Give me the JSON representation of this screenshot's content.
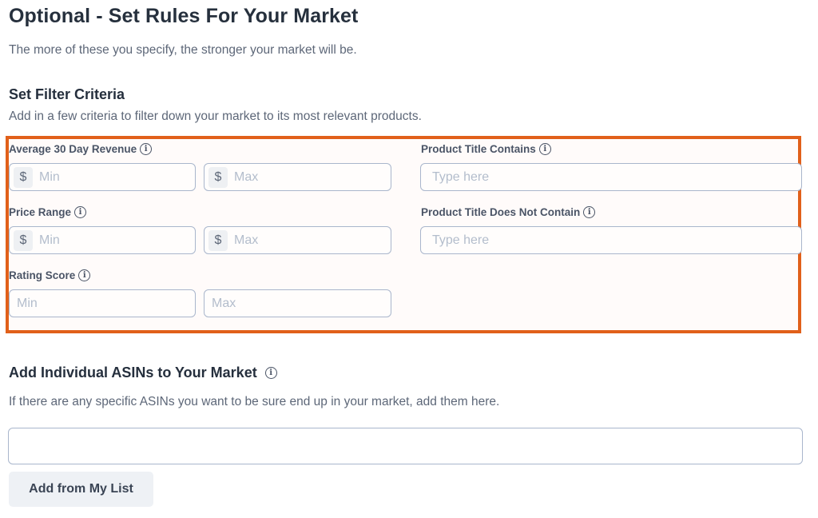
{
  "header": {
    "title": "Optional - Set Rules For Your Market",
    "subtitle": "The more of these you specify, the stronger your market will be."
  },
  "filter_section": {
    "title": "Set Filter Criteria",
    "description": "Add in a few criteria to filter down your market to its most relevant products.",
    "highlight_color": "#e1601a",
    "fields": {
      "avg_revenue": {
        "label": "Average 30 Day Revenue",
        "prefix": "$",
        "min_placeholder": "Min",
        "max_placeholder": "Max",
        "min_value": "",
        "max_value": ""
      },
      "price_range": {
        "label": "Price Range",
        "prefix": "$",
        "min_placeholder": "Min",
        "max_placeholder": "Max",
        "min_value": "",
        "max_value": ""
      },
      "rating_score": {
        "label": "Rating Score",
        "min_placeholder": "Min",
        "max_placeholder": "Max",
        "min_value": "",
        "max_value": ""
      },
      "title_contains": {
        "label": "Product Title Contains",
        "placeholder": "Type here",
        "value": ""
      },
      "title_not_contains": {
        "label": "Product Title Does Not Contain",
        "placeholder": "Type here",
        "value": ""
      }
    },
    "info_icon_glyph": "i"
  },
  "asin_section": {
    "title": "Add Individual ASINs to Your Market",
    "description": "If there are any specific ASINs you want to be sure end up in your market, add them here.",
    "input_value": "",
    "add_button_label": "Add from My List"
  }
}
